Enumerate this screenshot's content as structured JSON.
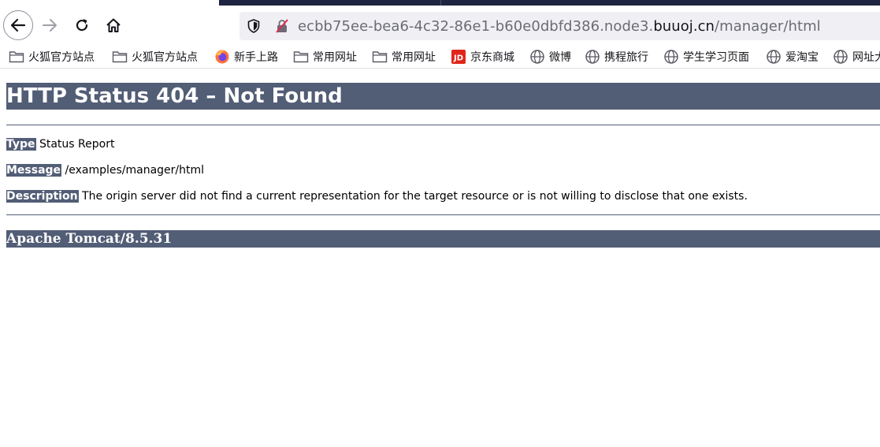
{
  "browser": {
    "url": {
      "prefix": "ecbb75ee-bea6-4c32-86e1-b60e0dbfd386.node3.",
      "domain": "buuoj.cn",
      "path": "/manager/html"
    },
    "nav": {
      "back_icon": "arrow-left-icon",
      "forward_icon": "arrow-right-icon",
      "reload_icon": "reload-icon",
      "home_icon": "home-icon"
    },
    "bookmarks": [
      {
        "label": "火狐官方站点",
        "icon": "folder-icon"
      },
      {
        "label": "火狐官方站点",
        "icon": "folder-icon"
      },
      {
        "label": "新手上路",
        "icon": "firefox-icon"
      },
      {
        "label": "常用网址",
        "icon": "folder-icon"
      },
      {
        "label": "常用网址",
        "icon": "folder-icon"
      },
      {
        "label": "京东商城",
        "icon": "jd-icon"
      },
      {
        "label": "微博",
        "icon": "globe-icon"
      },
      {
        "label": "携程旅行",
        "icon": "globe-icon"
      },
      {
        "label": "学生学习页面",
        "icon": "globe-icon"
      },
      {
        "label": "爱淘宝",
        "icon": "globe-icon"
      },
      {
        "label": "网址大",
        "icon": "globe-icon"
      }
    ]
  },
  "page": {
    "title": "HTTP Status 404 – Not Found",
    "type_label": "Type",
    "type_value": " Status Report",
    "message_label": "Message",
    "message_value": " /examples/manager/html",
    "description_label": "Description",
    "description_value": " The origin server did not find a current representation for the target resource or is not willing to disclose that one exists.",
    "footer": "Apache Tomcat/8.5.31",
    "colors": {
      "banner": "#525d76",
      "banner_text": "#ffffff"
    }
  }
}
